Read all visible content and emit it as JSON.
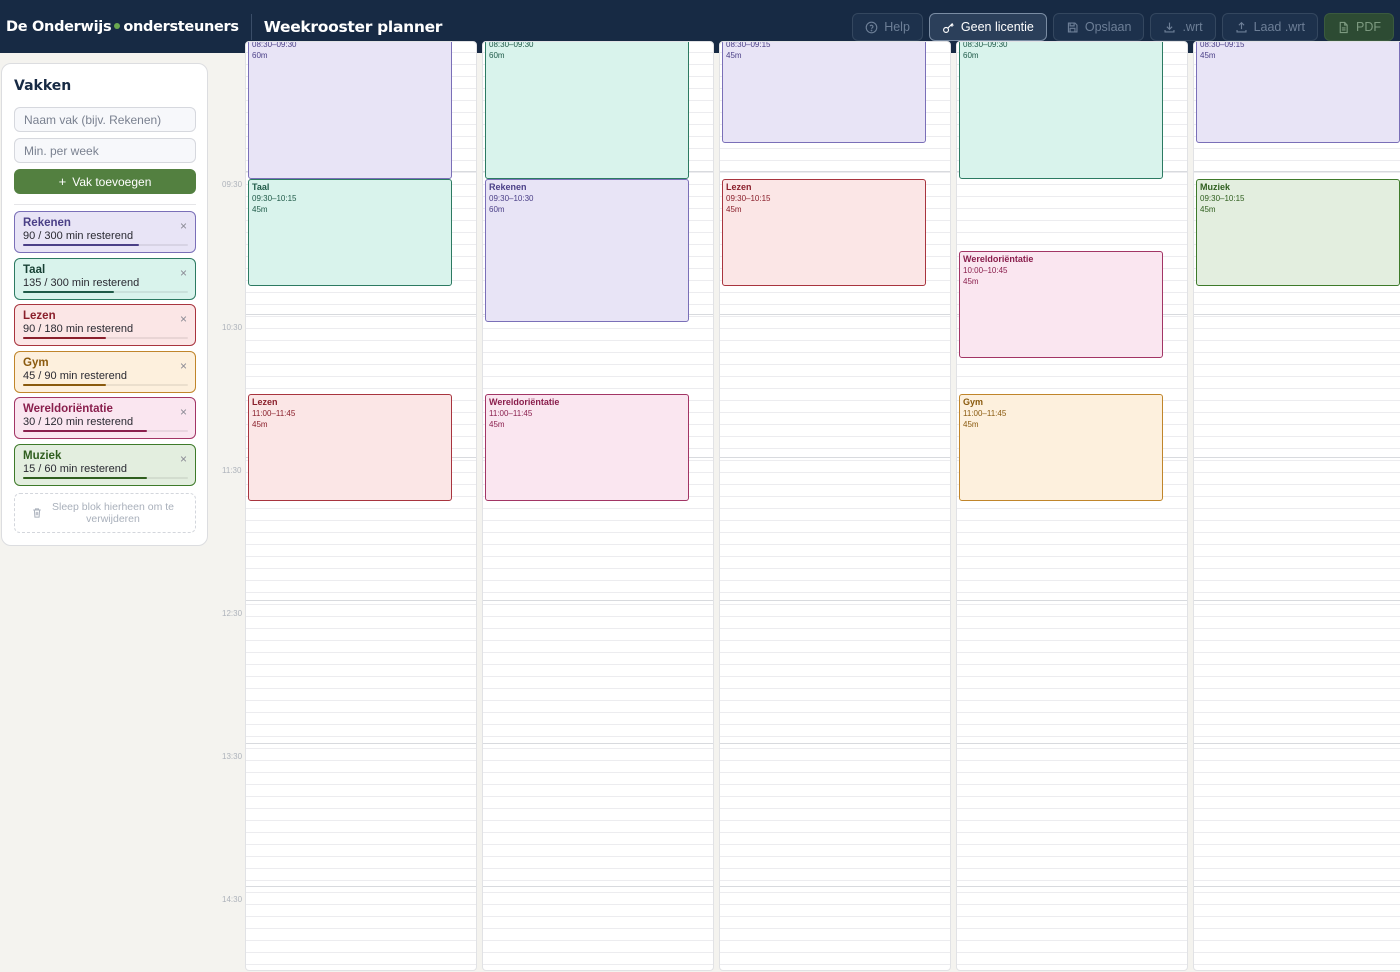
{
  "header": {
    "brand_left": "De Onderwijs",
    "brand_right": "ondersteuners",
    "app_title": "Weekrooster planner",
    "buttons": [
      {
        "label": "Help",
        "icon": "help-circle-icon"
      },
      {
        "label": "Geen licentie",
        "icon": "key-icon"
      },
      {
        "label": "Opslaan",
        "icon": "save-icon"
      },
      {
        "label": ".wrt",
        "icon": "download-icon"
      },
      {
        "label": "Laad .wrt",
        "icon": "upload-icon"
      },
      {
        "label": "PDF",
        "icon": "file-icon"
      }
    ]
  },
  "sidebar": {
    "title": "Vakken",
    "name_placeholder": "Naam vak (bijv. Rekenen)",
    "minutes_placeholder": "Min. per week",
    "add_label": "Vak toevoegen",
    "add_icon": "+",
    "remove_icon": "×",
    "trash_label": "Sleep blok hierheen om te verwijderen",
    "subjects": [
      {
        "name": "Rekenen",
        "remaining": "90 / 300 min resterend",
        "progress": 0.7,
        "color": "#4a3f87",
        "bg": "#e8e4f6",
        "border": "#7a6fb8"
      },
      {
        "name": "Taal",
        "remaining": "135 / 300 min resterend",
        "progress": 0.55,
        "color": "#1f5a48",
        "bg": "#d9f3ec",
        "border": "#2c7a62"
      },
      {
        "name": "Lezen",
        "remaining": "90 / 180 min resterend",
        "progress": 0.5,
        "color": "#8a1f2b",
        "bg": "#fbe6e6",
        "border": "#a8343e"
      },
      {
        "name": "Gym",
        "remaining": "45 / 90 min resterend",
        "progress": 0.5,
        "color": "#8a5a0e",
        "bg": "#fdf0dd",
        "border": "#c0852a"
      },
      {
        "name": "Wereldoriëntatie",
        "remaining": "30 / 120 min resterend",
        "progress": 0.75,
        "color": "#8a1f4d",
        "bg": "#fae6f0",
        "border": "#a23565"
      },
      {
        "name": "Muziek",
        "remaining": "15 / 60 min resterend",
        "progress": 0.75,
        "color": "#2f5e1e",
        "bg": "#e3eedf",
        "border": "#3e7a2a"
      }
    ]
  },
  "time_labels": [
    "09:30",
    "10:30",
    "11:30",
    "12:30",
    "13:30",
    "14:30"
  ],
  "days": [
    {
      "blocks": [
        {
          "name": "",
          "time": "08:30–09:30",
          "dur": "60m",
          "subject": 0,
          "start_min": 510,
          "end_min": 570
        },
        {
          "name": "Taal",
          "time": "09:30–10:15",
          "dur": "45m",
          "subject": 1,
          "start_min": 570,
          "end_min": 615
        },
        {
          "name": "Lezen",
          "time": "11:00–11:45",
          "dur": "45m",
          "subject": 2,
          "start_min": 660,
          "end_min": 705
        }
      ]
    },
    {
      "blocks": [
        {
          "name": "",
          "time": "08:30–09:30",
          "dur": "60m",
          "subject": 1,
          "start_min": 510,
          "end_min": 570
        },
        {
          "name": "Rekenen",
          "time": "09:30–10:30",
          "dur": "60m",
          "subject": 0,
          "start_min": 570,
          "end_min": 630
        },
        {
          "name": "Wereldoriëntatie",
          "time": "11:00–11:45",
          "dur": "45m",
          "subject": 4,
          "start_min": 660,
          "end_min": 705
        }
      ]
    },
    {
      "blocks": [
        {
          "name": "",
          "time": "08:30–09:15",
          "dur": "45m",
          "subject": 0,
          "start_min": 510,
          "end_min": 555
        },
        {
          "name": "Lezen",
          "time": "09:30–10:15",
          "dur": "45m",
          "subject": 2,
          "start_min": 570,
          "end_min": 615
        }
      ]
    },
    {
      "blocks": [
        {
          "name": "",
          "time": "08:30–09:30",
          "dur": "60m",
          "subject": 1,
          "start_min": 510,
          "end_min": 570
        },
        {
          "name": "Wereldoriëntatie",
          "time": "10:00–10:45",
          "dur": "45m",
          "subject": 4,
          "start_min": 600,
          "end_min": 645
        },
        {
          "name": "Gym",
          "time": "11:00–11:45",
          "dur": "45m",
          "subject": 3,
          "start_min": 660,
          "end_min": 705
        }
      ]
    },
    {
      "blocks": [
        {
          "name": "",
          "time": "08:30–09:15",
          "dur": "45m",
          "subject": 0,
          "start_min": 510,
          "end_min": 555
        },
        {
          "name": "Muziek",
          "time": "09:30–10:15",
          "dur": "45m",
          "subject": 5,
          "start_min": 570,
          "end_min": 615
        }
      ]
    }
  ]
}
